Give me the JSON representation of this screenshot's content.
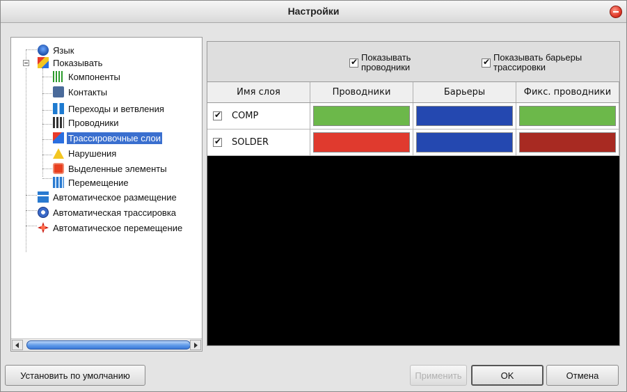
{
  "window": {
    "title": "Настройки"
  },
  "tree": {
    "items": [
      {
        "label": "Язык",
        "icon": "language-icon"
      },
      {
        "label": "Показывать",
        "icon": "show-icon"
      },
      {
        "label": "Компоненты",
        "icon": "components-icon"
      },
      {
        "label": "Контакты",
        "icon": "contacts-icon"
      },
      {
        "label": "Переходы и ветвления",
        "icon": "vias-icon"
      },
      {
        "label": "Проводники",
        "icon": "wires-icon"
      },
      {
        "label": "Трассировочные слои",
        "icon": "layers-icon"
      },
      {
        "label": "Нарушения",
        "icon": "warning-icon"
      },
      {
        "label": "Выделенные элементы",
        "icon": "selection-icon"
      },
      {
        "label": "Перемещение",
        "icon": "move-icon"
      },
      {
        "label": "Автоматическое размещение",
        "icon": "auto-place-icon"
      },
      {
        "label": "Автоматическая трассировка",
        "icon": "auto-route-icon"
      },
      {
        "label": "Автоматическое перемещение",
        "icon": "auto-move-icon"
      }
    ],
    "selected_index": 6
  },
  "options": {
    "show_wires": {
      "label_line1": "Показывать",
      "label_line2": "проводники",
      "checked": true
    },
    "show_barriers": {
      "label_line1": "Показывать барьеры",
      "label_line2": "трассировки",
      "checked": true
    }
  },
  "grid": {
    "headers": [
      "Имя слоя",
      "Проводники",
      "Барьеры",
      "Фикс. проводники"
    ],
    "rows": [
      {
        "name": "COMP",
        "checked": true,
        "colors": [
          "#6cb84a",
          "#2448b0",
          "#6cb84a"
        ]
      },
      {
        "name": "SOLDER",
        "checked": true,
        "colors": [
          "#e03a2e",
          "#2448b0",
          "#a82a22"
        ]
      }
    ]
  },
  "buttons": {
    "defaults": "Установить по умолчанию",
    "apply": "Применить",
    "ok": "OK",
    "cancel": "Отмена"
  }
}
